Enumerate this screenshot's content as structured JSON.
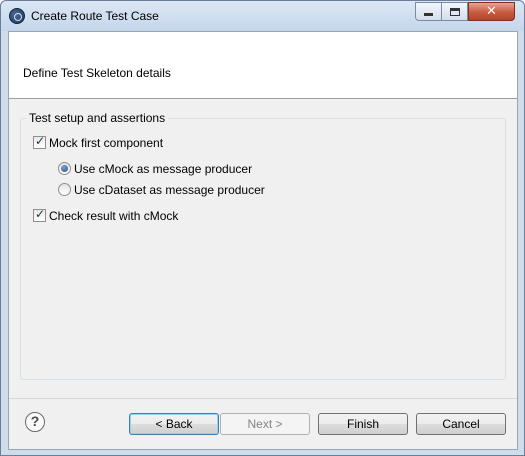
{
  "window": {
    "title": "Create Route Test Case",
    "icon": "eclipse-app-icon"
  },
  "titlebar_buttons": {
    "minimize": "minimize-icon",
    "maximize": "maximize-icon",
    "close": "close-icon",
    "close_glyph": "✕"
  },
  "header": {
    "title": "Define Test Skeleton details"
  },
  "group": {
    "label": "Test setup and assertions",
    "mock_first": {
      "label": "Mock first component",
      "checked": true
    },
    "producer_options": [
      {
        "label": "Use cMock as message producer",
        "selected": true
      },
      {
        "label": "Use cDataset as message producer",
        "selected": false
      }
    ],
    "check_result": {
      "label": "Check result with cMock",
      "checked": true
    }
  },
  "footer": {
    "help_glyph": "?",
    "back": "< Back",
    "next": "Next >",
    "finish": "Finish",
    "cancel": "Cancel"
  },
  "colors": {
    "window_frame": "#cfdcec",
    "dialog_bg": "#f0f0f0",
    "header_bg": "#ffffff",
    "close_button": "#c75a3f",
    "focus_border": "#3c7fb1"
  }
}
